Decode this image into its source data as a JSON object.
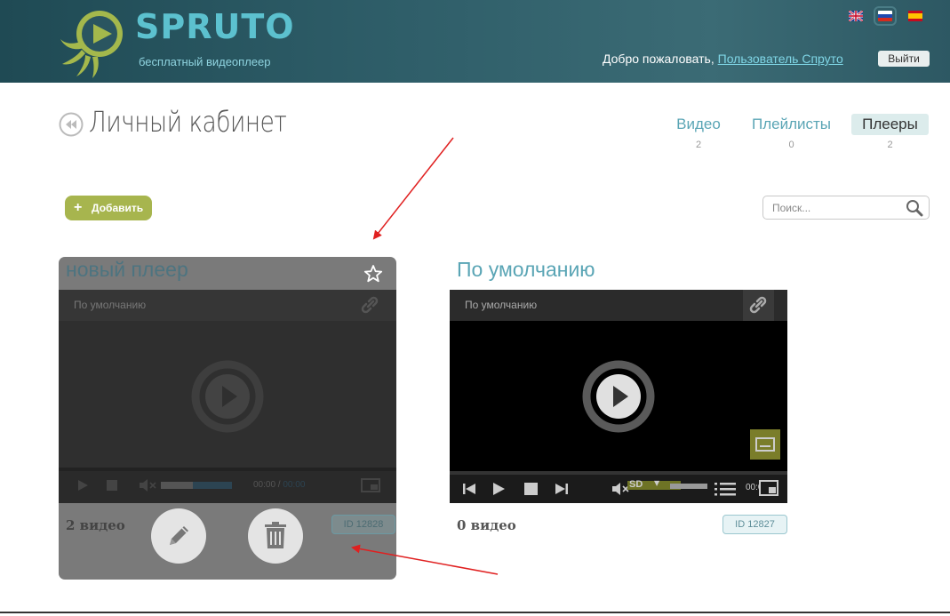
{
  "header": {
    "brand": "SPRUTO",
    "tagline": "бесплатный видеоплеер",
    "welcome_text": "Добро пожаловать, ",
    "user_name": "Пользователь Спруто",
    "logout_label": "Выйти",
    "languages": [
      "en",
      "ru",
      "es"
    ],
    "selected_language": "ru"
  },
  "page": {
    "title": "Личный кабинет"
  },
  "tabs": [
    {
      "label": "Видео",
      "count": "2"
    },
    {
      "label": "Плейлисты",
      "count": "0"
    },
    {
      "label": "Плееры",
      "count": "2",
      "active": true
    }
  ],
  "toolbar": {
    "add_label": "Добавить",
    "search_placeholder": "Поиск..."
  },
  "players": [
    {
      "title": "новый плеер",
      "preview_label": "По умолчанию",
      "time": "00:00",
      "duration": "00:00",
      "videos": "2 видео",
      "id": "ID 12828"
    },
    {
      "title": "По умолчанию",
      "preview_label": "По умолчанию",
      "quality": "SD",
      "time": "00:00",
      "videos": "0 видео",
      "id": "ID 12827"
    }
  ],
  "colors": {
    "accent": "#5aa5b5",
    "add_button": "#a7b54e",
    "header_bg": "#2e5d68"
  }
}
